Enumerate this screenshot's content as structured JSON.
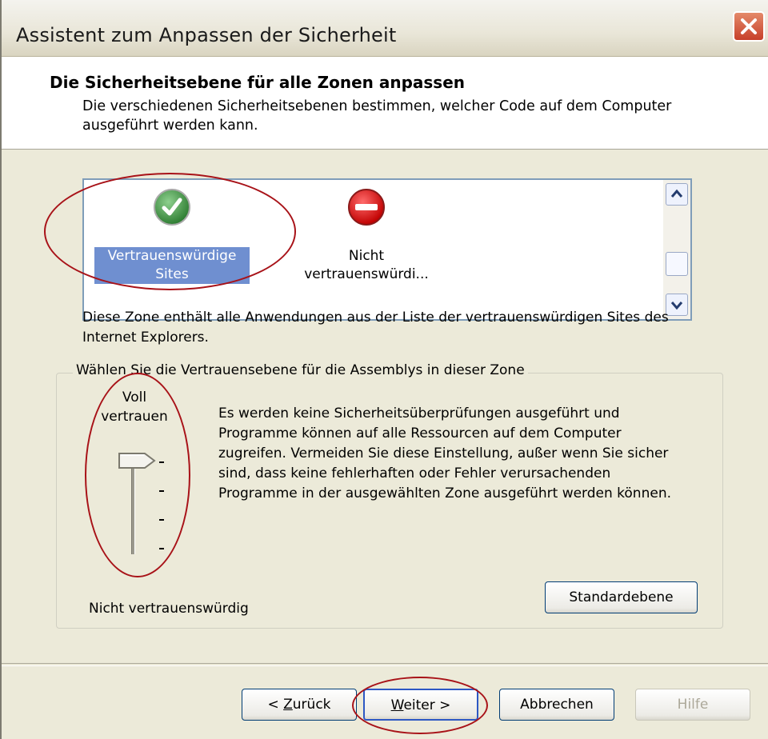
{
  "window": {
    "title": "Assistent zum Anpassen der Sicherheit",
    "close_label": "close"
  },
  "header": {
    "title": "Die Sicherheitsebene für alle Zonen anpassen",
    "description": "Die verschiedenen Sicherheitsebenen bestimmen, welcher Code auf dem Computer ausgeführt werden kann."
  },
  "zones": {
    "items": [
      {
        "label": "Vertrauenswürdige Sites",
        "icon": "check-circle-icon",
        "selected": true,
        "color": "#3f9a3f"
      },
      {
        "label": "Nicht vertrauenswürdi...",
        "icon": "no-entry-icon",
        "selected": false,
        "color": "#d40000"
      }
    ],
    "description": "Diese Zone enthält alle Anwendungen aus der Liste der vertrauenswürdigen Sites des Internet Explorers."
  },
  "trust_group": {
    "legend": "Wählen Sie die Vertrauensebene für die Assemblys in dieser Zone",
    "slider": {
      "top_label": "Voll vertrauen",
      "bottom_label": "Nicht vertrauenswürdig",
      "levels": 4,
      "selected_level": 4
    },
    "level_description": "Es werden keine Sicherheitsüberprüfungen ausgeführt und Programme können auf alle Ressourcen auf dem Computer zugreifen. Vermeiden Sie diese Einstellung, außer wenn Sie sicher sind, dass keine fehlerhaften oder Fehler verursachenden Programme in der ausgewählten Zone ausgeführt werden können.",
    "default_button": "Standardebene"
  },
  "footer": {
    "back_prefix": "< ",
    "back_mnemonic": "Z",
    "back_rest": "urück",
    "next_mnemonic": "W",
    "next_rest": "eiter",
    "next_suffix": " >",
    "cancel": "Abbrechen",
    "help": "Hilfe"
  },
  "colors": {
    "dialog_bg": "#ecead9",
    "selection": "#6f8fd0",
    "annotation": "#a81218"
  }
}
